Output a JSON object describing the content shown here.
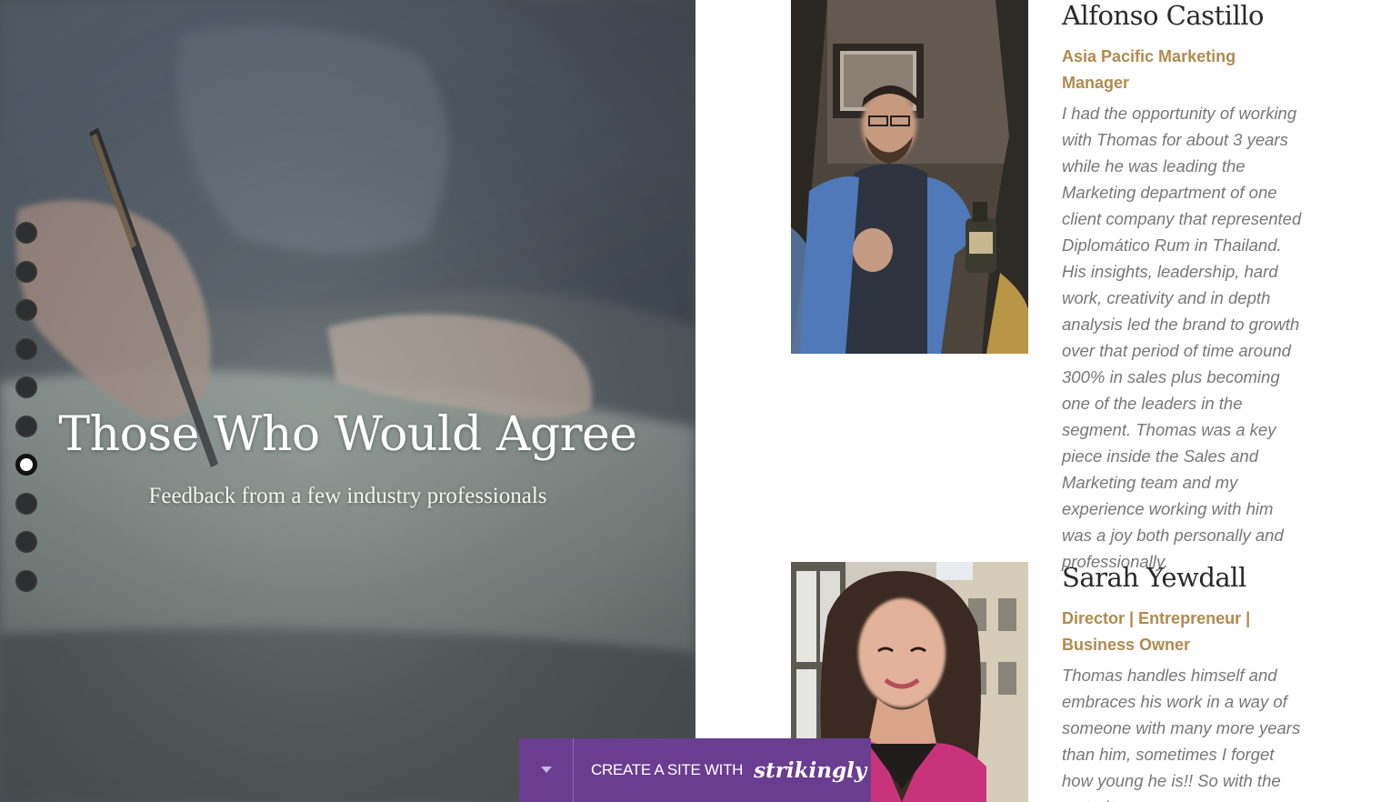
{
  "hero": {
    "title": "Those Who Would Agree",
    "subtitle": "Feedback from a few industry professionals"
  },
  "dot_nav": {
    "count": 10,
    "active_index": 6
  },
  "testimonials": [
    {
      "name": "Alfonso Castillo",
      "role": "Asia Pacific Marketing Manager",
      "quote": "I had the opportunity of working with Thomas for about 3 years while he was leading the Marketing department of one client company that represented Diplomático Rum in Thailand. His insights, leadership, hard work, creativity and in depth analysis led the brand to growth over that period of time around 300% in sales plus becoming one of the leaders in the segment. Thomas was a key piece inside the Sales and Marketing team and my experience working with him was a joy both personally and professionally."
    },
    {
      "name": "Sarah Yewdall",
      "role": "Director | Entrepreneur | Business Owner",
      "quote": "Thomas handles himself and embraces his work in a way of someone with many more years than him, sometimes I forget how young he is!! So with the maturity"
    }
  ],
  "strikingly_bar": {
    "text": "CREATE A SITE WITH",
    "brand": "strikingly",
    "caret_icon": "caret-down-icon"
  },
  "colors": {
    "accent_gold": "#b08a4e",
    "bar_purple": "#6a3d91",
    "quote_gray": "#777777"
  }
}
